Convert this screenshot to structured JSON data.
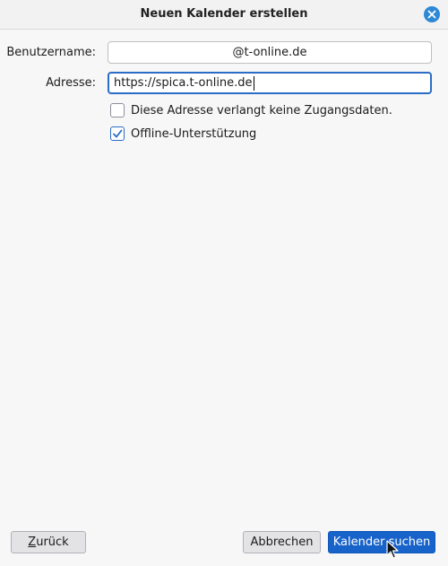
{
  "dialog": {
    "title": "Neuen Kalender erstellen"
  },
  "form": {
    "username_label": "Benutzername:",
    "username_value": "@t-online.de",
    "address_label": "Adresse:",
    "address_value": "https://spica.t-online.de",
    "no_credentials_label": "Diese Adresse verlangt keine Zugangsdaten.",
    "no_credentials_checked": false,
    "offline_label": "Offline-Unterstützung",
    "offline_checked": true
  },
  "footer": {
    "back_key": "Z",
    "back_rest": "urück",
    "cancel_label": "Abbrechen",
    "find_label": "Kalender suchen"
  },
  "colors": {
    "accent": "#2b6cc4",
    "primary_button": "#1863c9",
    "close_button": "#2d88d5"
  },
  "icons": {
    "close": "close-icon",
    "check": "checkmark-icon",
    "pointer": "mouse-pointer-icon"
  }
}
